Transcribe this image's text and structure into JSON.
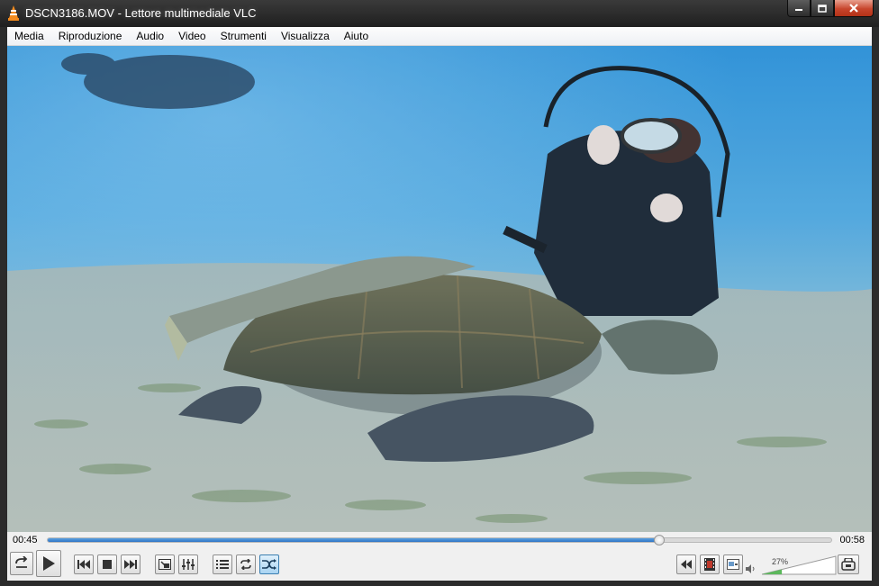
{
  "window": {
    "title": "DSCN3186.MOV - Lettore multimediale VLC"
  },
  "menu": [
    {
      "label": "Media"
    },
    {
      "label": "Riproduzione"
    },
    {
      "label": "Audio"
    },
    {
      "label": "Video"
    },
    {
      "label": "Strumenti"
    },
    {
      "label": "Visualizza"
    },
    {
      "label": "Aiuto"
    }
  ],
  "playback": {
    "elapsed": "00:45",
    "total": "00:58",
    "progress": 0.78
  },
  "volume": {
    "label": "27%",
    "level": 0.27
  },
  "controls": {
    "left": [
      "reverse-icon",
      "play-icon"
    ],
    "transport": [
      "previous-icon",
      "stop-icon",
      "next-icon"
    ],
    "view": [
      "fullscreen-icon",
      "extended-settings-icon"
    ],
    "list": [
      "playlist-icon",
      "loop-icon",
      "shuffle-icon"
    ],
    "right": [
      "frame-back-icon",
      "record-icon",
      "snapshot-icon"
    ],
    "far_right": "ab-loop-icon"
  },
  "colors": {
    "accent": "#2f74c6",
    "title_bar": "#1f1f1f",
    "close_button": "#c7452c",
    "volume_fill": "#5cb85c"
  }
}
